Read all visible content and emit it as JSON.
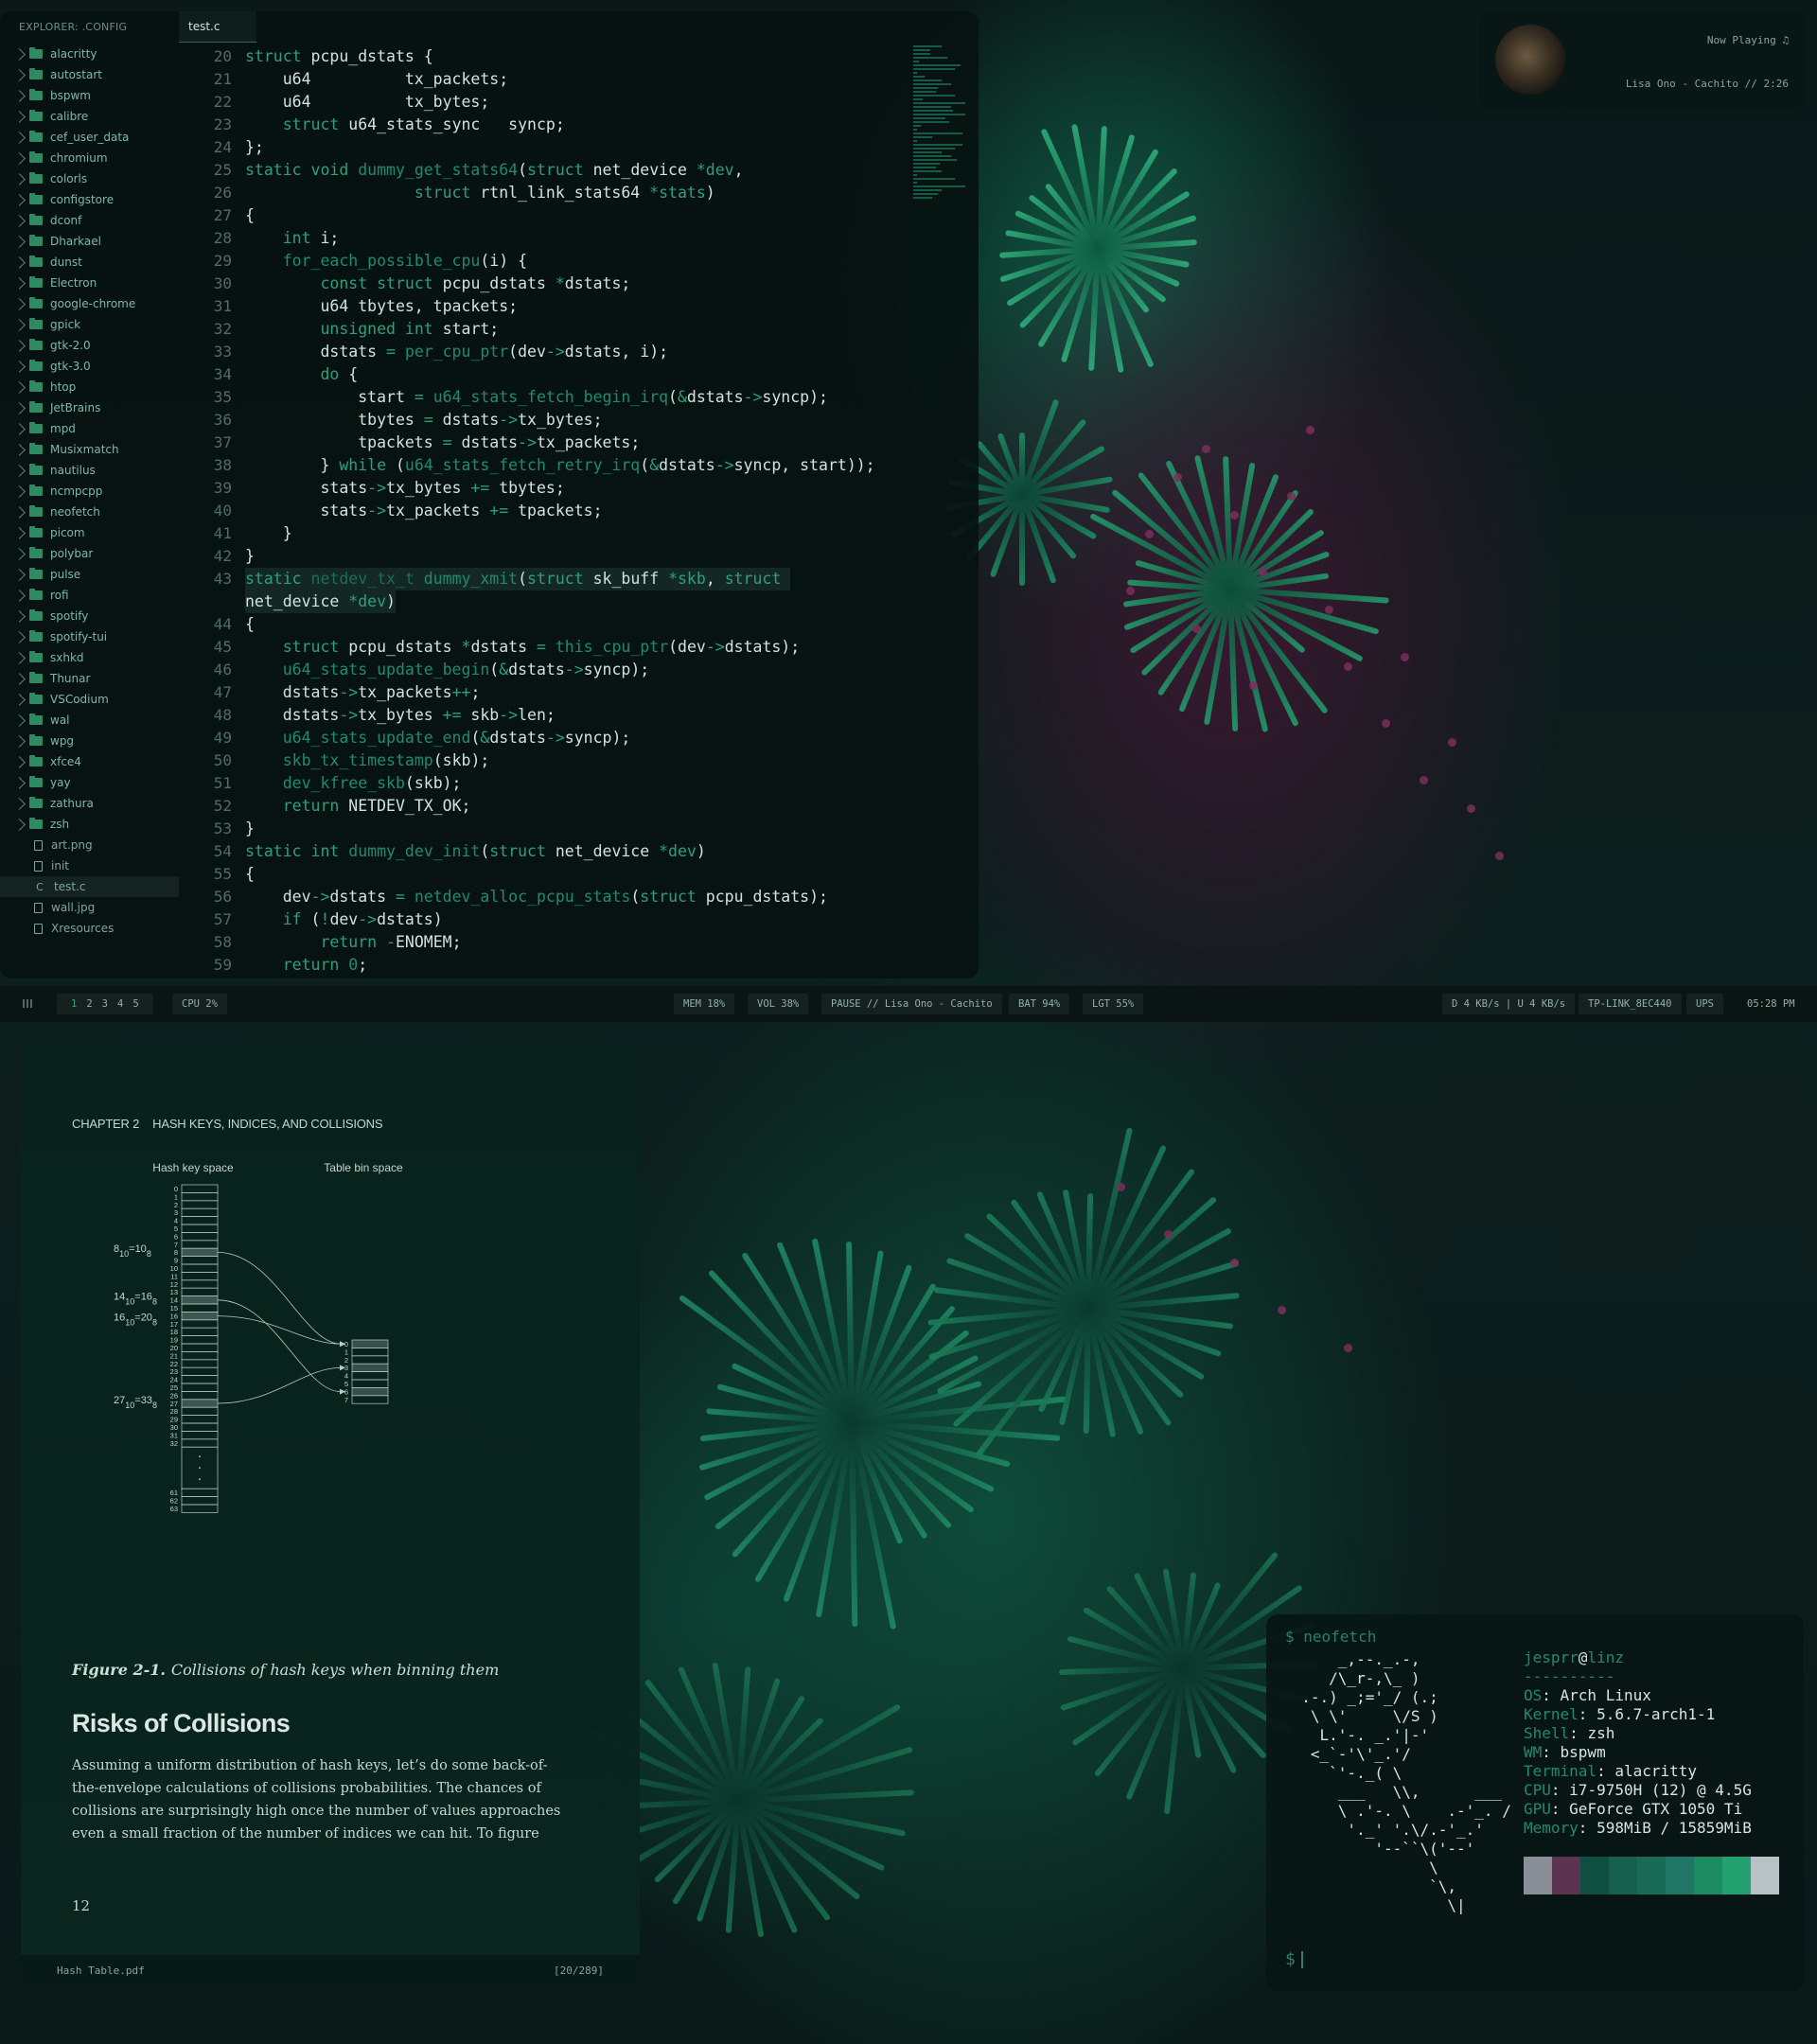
{
  "colors": {
    "accent": "#1e8c6a",
    "keyword": "#2f9f79",
    "window_bg": "#061211",
    "text": "#d2e2dd",
    "bar_bg": "#091413"
  },
  "editor": {
    "explorer_header": "EXPLORER: .CONFIG",
    "tab": "test.c",
    "folders": [
      "alacritty",
      "autostart",
      "bspwm",
      "calibre",
      "cef_user_data",
      "chromium",
      "colorls",
      "configstore",
      "dconf",
      "Dharkael",
      "dunst",
      "Electron",
      "google-chrome",
      "gpick",
      "gtk-2.0",
      "gtk-3.0",
      "htop",
      "JetBrains",
      "mpd",
      "Musixmatch",
      "nautilus",
      "ncmpcpp",
      "neofetch",
      "picom",
      "polybar",
      "pulse",
      "rofi",
      "spotify",
      "spotify-tui",
      "sxhkd",
      "Thunar",
      "VSCodium",
      "wal",
      "wpg",
      "xfce4",
      "yay",
      "zathura",
      "zsh"
    ],
    "files": [
      {
        "name": "art.png",
        "icon": "image-file-icon"
      },
      {
        "name": "init",
        "icon": "file-icon"
      },
      {
        "name": "test.c",
        "icon": "c-file-icon",
        "active": true
      },
      {
        "name": "wall.jpg",
        "icon": "image-file-icon"
      },
      {
        "name": "Xresources",
        "icon": "file-icon"
      }
    ],
    "code_lines": [
      {
        "n": "20",
        "h": "<span class='k'>struct</span> pcpu_dstats {"
      },
      {
        "n": "21",
        "h": "    u64          tx_packets;"
      },
      {
        "n": "22",
        "h": "    u64          tx_bytes;"
      },
      {
        "n": "23",
        "h": "    <span class='k'>struct</span> u64_stats_sync   syncp;"
      },
      {
        "n": "24",
        "h": "};"
      },
      {
        "n": "25",
        "h": "<span class='k'>static void</span> <span class='f'>dummy_get_stats64</span>(<span class='k'>struct</span> net_device <span class='o'>*dev</span>,"
      },
      {
        "n": "26",
        "h": "                  <span class='k'>struct</span> rtnl_link_stats64 <span class='o'>*stats</span>)"
      },
      {
        "n": "27",
        "h": "{"
      },
      {
        "n": "28",
        "h": "    <span class='k'>int</span> i;"
      },
      {
        "n": "29",
        "h": "    <span class='f'>for_each_possible_cpu</span>(i) {"
      },
      {
        "n": "30",
        "h": "        <span class='k'>const struct</span> pcpu_dstats <span class='o'>*</span>dstats;"
      },
      {
        "n": "31",
        "h": "        u64 tbytes, tpackets;"
      },
      {
        "n": "32",
        "h": "        <span class='k'>unsigned int</span> start;"
      },
      {
        "n": "33",
        "h": "        dstats <span class='o'>=</span> <span class='f'>per_cpu_ptr</span>(dev<span class='o'>-&gt;</span>dstats, i);"
      },
      {
        "n": "34",
        "h": "        <span class='k'>do</span> {"
      },
      {
        "n": "35",
        "h": "            start <span class='o'>=</span> <span class='f'>u64_stats_fetch_begin_irq</span>(<span class='o'>&amp;</span>dstats<span class='o'>-&gt;</span>syncp);"
      },
      {
        "n": "36",
        "h": "            tbytes <span class='o'>=</span> dstats<span class='o'>-&gt;</span>tx_bytes;"
      },
      {
        "n": "37",
        "h": "            tpackets <span class='o'>=</span> dstats<span class='o'>-&gt;</span>tx_packets;"
      },
      {
        "n": "38",
        "h": "        } <span class='k'>while</span> (<span class='f'>u64_stats_fetch_retry_irq</span>(<span class='o'>&amp;</span>dstats<span class='o'>-&gt;</span>syncp, start));"
      },
      {
        "n": "39",
        "h": "        stats<span class='o'>-&gt;</span>tx_bytes <span class='o'>+=</span> tbytes;"
      },
      {
        "n": "40",
        "h": "        stats<span class='o'>-&gt;</span>tx_packets <span class='o'>+=</span> tpackets;"
      },
      {
        "n": "41",
        "h": "    }"
      },
      {
        "n": "42",
        "h": "}"
      },
      {
        "n": "43",
        "h": "<span class='k'>static</span> <span class='d'>netdev_tx_t</span> <span class='f'>dummy_xmit</span>(<span class='k'>struct</span> sk_buff <span class='o'>*skb</span>, <span class='k'>struct</span> ",
        "hl": true
      },
      {
        "n": "",
        "h": "net_device <span class='o'>*dev</span>)",
        "hl": true
      },
      {
        "n": "44",
        "h": "{"
      },
      {
        "n": "45",
        "h": "    <span class='k'>struct</span> pcpu_dstats <span class='o'>*</span>dstats <span class='o'>=</span> <span class='f'>this_cpu_ptr</span>(dev<span class='o'>-&gt;</span>dstats);"
      },
      {
        "n": "46",
        "h": "    <span class='f'>u64_stats_update_begin</span>(<span class='o'>&amp;</span>dstats<span class='o'>-&gt;</span>syncp);"
      },
      {
        "n": "47",
        "h": "    dstats<span class='o'>-&gt;</span>tx_packets<span class='o'>++</span>;"
      },
      {
        "n": "48",
        "h": "    dstats<span class='o'>-&gt;</span>tx_bytes <span class='o'>+=</span> skb<span class='o'>-&gt;</span>len;"
      },
      {
        "n": "49",
        "h": "    <span class='f'>u64_stats_update_end</span>(<span class='o'>&amp;</span>dstats<span class='o'>-&gt;</span>syncp);"
      },
      {
        "n": "50",
        "h": "    <span class='f'>skb_tx_timestamp</span>(skb);"
      },
      {
        "n": "51",
        "h": "    <span class='f'>dev_kfree_skb</span>(skb);"
      },
      {
        "n": "52",
        "h": "    <span class='k'>return</span> NETDEV_TX_OK;"
      },
      {
        "n": "53",
        "h": "}"
      },
      {
        "n": "54",
        "h": "<span class='k'>static int</span> <span class='f'>dummy_dev_init</span>(<span class='k'>struct</span> net_device <span class='o'>*dev</span>)"
      },
      {
        "n": "55",
        "h": "{"
      },
      {
        "n": "56",
        "h": "    dev<span class='o'>-&gt;</span>dstats <span class='o'>=</span> <span class='f'>netdev_alloc_pcpu_stats</span>(<span class='k'>struct</span> pcpu_dstats);"
      },
      {
        "n": "57",
        "h": "    <span class='k'>if</span> (<span class='o'>!</span>dev<span class='o'>-&gt;</span>dstats)"
      },
      {
        "n": "58",
        "h": "        <span class='k'>return</span> <span class='o'>-</span>ENOMEM;"
      },
      {
        "n": "59",
        "h": "    <span class='k'>return</span> <span class='f'>0</span>;"
      }
    ]
  },
  "now_playing": {
    "title": "Now Playing ♫",
    "track": "Lisa Ono - Cachito // 2:26"
  },
  "bar": {
    "workspaces": [
      "1",
      "2",
      "3",
      "4",
      "5"
    ],
    "cpu": "CPU 2%",
    "mem": "MEM 18%",
    "vol": "VOL 38%",
    "media": "PAUSE // Lisa Ono - Cachito",
    "bat": "BAT 94%",
    "lgt": "LGT 55%",
    "net": "D 4 KB/s | U 4 KB/s",
    "wifi": "TP-LINK_8EC440",
    "ups": "UPS",
    "time": "05:28 PM"
  },
  "pdf": {
    "chapter": "CHAPTER 2",
    "chapter_title": "HASH KEYS, INDICES, AND COLLISIONS",
    "diagram": {
      "left_title": "Hash key space",
      "right_title": "Table bin space",
      "key_labels_top": [
        "0",
        "1",
        "2",
        "3",
        "4",
        "5",
        "6",
        "7",
        "8",
        "9",
        "10",
        "11",
        "12",
        "13",
        "14",
        "15",
        "16",
        "17",
        "18",
        "19",
        "20",
        "21",
        "22",
        "23",
        "24",
        "25",
        "26",
        "27",
        "28",
        "29",
        "30",
        "31",
        "32"
      ],
      "key_labels_bottom": [
        "61",
        "62",
        "63"
      ],
      "bin_labels": [
        "0",
        "1",
        "2",
        "3",
        "4",
        "5",
        "6",
        "7"
      ],
      "highlighted_keys": [
        8,
        14,
        16,
        27
      ],
      "annotations": [
        {
          "a": "8",
          "b": "10",
          "c": "=10",
          "d": "8"
        },
        {
          "a": "14",
          "b": "10",
          "c": "=16",
          "d": "8"
        },
        {
          "a": "16",
          "b": "10",
          "c": "=20",
          "d": "8"
        },
        {
          "a": "27",
          "b": "10",
          "c": "=33",
          "d": "8"
        }
      ]
    },
    "figure_label": "Figure 2-1.",
    "figure_caption": "Collisions of hash keys when binning them",
    "section_title": "Risks of Collisions",
    "paragraph": "Assuming a uniform distribution of hash keys, let’s do some back-of-the-envelope calculations of collisions probabilities. The chances of collisions are surprisingly high once the number of values approaches even a small fraction of the number of indices we can hit. To figure",
    "page_number": "12",
    "file": "Hash Table.pdf",
    "position": "[20/289]"
  },
  "terminal": {
    "command": "$ neofetch",
    "ascii": "      _,--._.-,\n     /\\_r-,\\_ )\n  .-.) _;='_/ (.;\n   \\ \\'     \\/S )\n    L.'-. _.'|-'\n   <_`-'\\'_.'/\n     `'-._( \\\n      ___   \\\\,      ___\n      \\ .'-. \\    .-'_. /\n       '._' '.\\/.-'_.'\n          '--``\\('--'\n                \\\n                `\\,\n                  \\|",
    "user": "jesprr",
    "host": "linz",
    "separator": "----------",
    "info": [
      {
        "k": "OS",
        "v": "Arch Linux"
      },
      {
        "k": "Kernel",
        "v": "5.6.7-arch1-1"
      },
      {
        "k": "Shell",
        "v": "zsh"
      },
      {
        "k": "WM",
        "v": "bspwm"
      },
      {
        "k": "Terminal",
        "v": "alacritty"
      },
      {
        "k": "CPU",
        "v": "i7-9750H (12) @ 4.5G"
      },
      {
        "k": "GPU",
        "v": "GeForce GTX 1050 Ti"
      },
      {
        "k": "Memory",
        "v": "598MiB / 15859MiB"
      }
    ],
    "palette": [
      "#8a8f97",
      "#5a3450",
      "#0f4f42",
      "#17604f",
      "#1a6a58",
      "#217565",
      "#1c8a63",
      "#22a06f",
      "#b8c2c6"
    ],
    "prompt": "$"
  }
}
